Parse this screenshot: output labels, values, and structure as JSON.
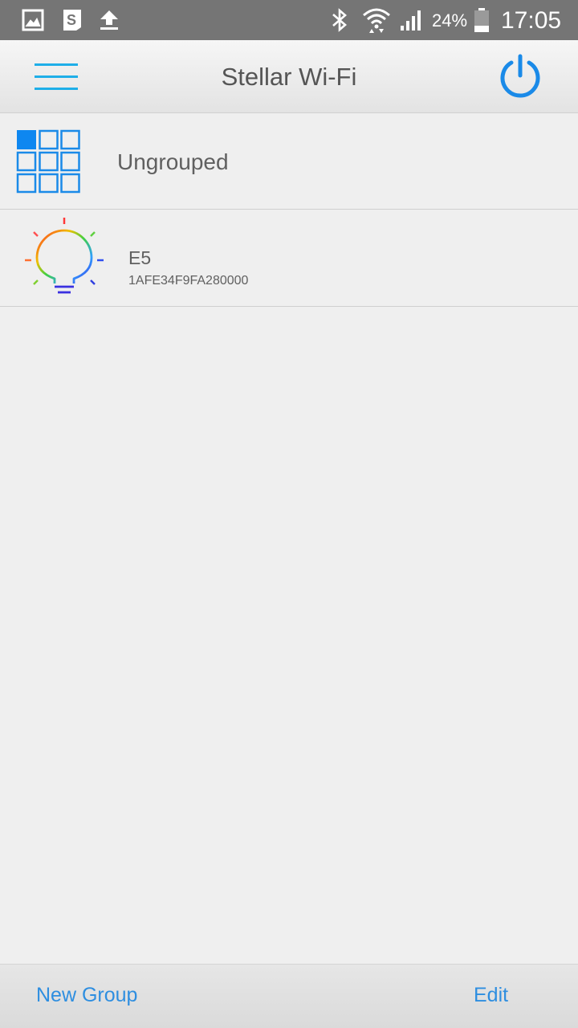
{
  "status_bar": {
    "battery_percent": "24%",
    "time": "17:05",
    "icons": [
      "gallery-icon",
      "s-app-icon",
      "upload-icon",
      "bluetooth-icon",
      "wifi-icon",
      "signal-icon",
      "battery-icon"
    ]
  },
  "app_bar": {
    "title": "Stellar Wi-Fi",
    "menu_icon": "hamburger-menu-icon",
    "power_icon": "power-icon",
    "accent_color": "#1a8ae8"
  },
  "groups": [
    {
      "label": "Ungrouped",
      "icon": "grid-group-icon"
    }
  ],
  "devices": [
    {
      "name": "E5",
      "id": "1AFE34F9FA280000",
      "icon": "rgb-bulb-icon"
    }
  ],
  "bottom_bar": {
    "new_group_label": "New Group",
    "edit_label": "Edit",
    "link_color": "#2e8ee0"
  }
}
